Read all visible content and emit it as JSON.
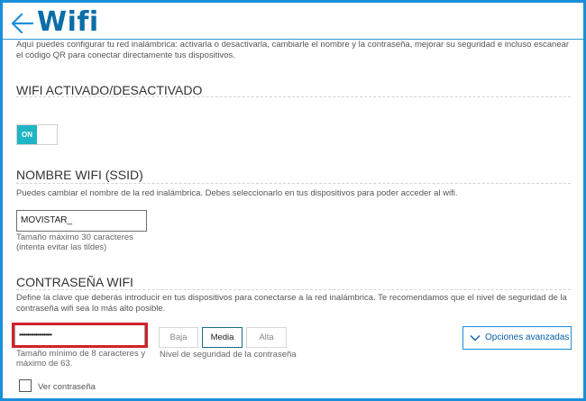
{
  "header": {
    "title": "Wifi"
  },
  "intro": "Aquí puedes configurar tu red inalámbrica: activarla o desactivarla, cambiarle el nombre y la contraseña, mejorar su seguridad e incluso escanear el código QR para conectar directamente tus dispositivos.",
  "wifi_toggle": {
    "title": "WIFI ACTIVADO/DESACTIVADO",
    "state_label": "ON"
  },
  "ssid": {
    "title": "NOMBRE WIFI (SSID)",
    "description": "Puedes cambiar el nombre de la red inalámbrica. Debes seleccionarlo en tus dispositivos para poder acceder al wifi.",
    "value": "MOVISTAR_",
    "hint_line1": "Tamaño máximo 30 caracteres",
    "hint_line2": "(intenta evitar las tildes)"
  },
  "password": {
    "title": "CONTRASEÑA WIFI",
    "description": "Define la clave que deberás introducir en tus dispositivos para conectarse a la red inalámbrica. Te recomendamos que el nivel de seguridad de la contraseña wifi sea lo más alto posible.",
    "masked_value": "••••••••••••••••••••",
    "hint_line1": "Tamaño mínimo de 8 caracteres y",
    "hint_line2": "máximo de 63.",
    "levels": [
      "Baja",
      "Media",
      "Alta"
    ],
    "selected_level": "Media",
    "level_caption": "Nivel de seguridad de la contraseña",
    "advanced_button": "Opciones avanzadas",
    "show_password_label": "Ver contraseña"
  },
  "colors": {
    "brand_blue": "#0b6ea8",
    "frame_blue": "#1a8fd9",
    "toggle_teal": "#1fb5c4",
    "highlight_red": "#d0232a"
  }
}
